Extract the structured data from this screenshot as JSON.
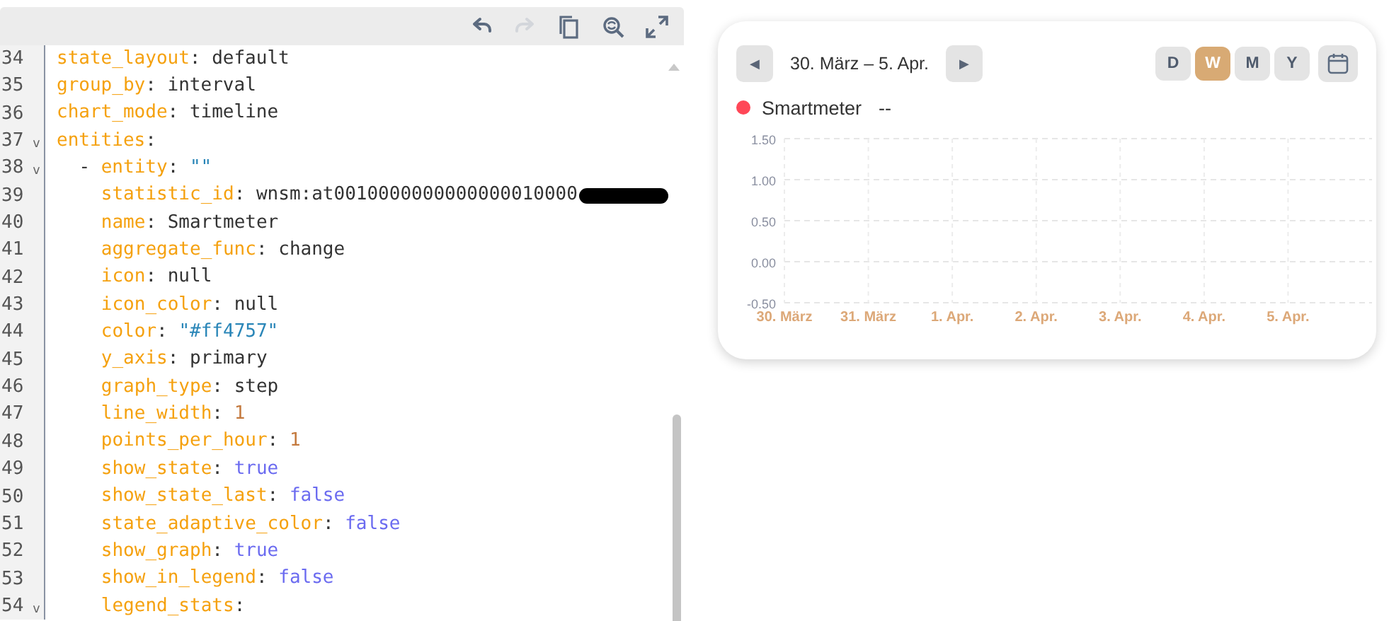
{
  "editor": {
    "toolbar": [
      {
        "kind": "undo",
        "disabled": false
      },
      {
        "kind": "redo",
        "disabled": true
      },
      {
        "kind": "copy",
        "disabled": false
      },
      {
        "kind": "search",
        "disabled": false
      },
      {
        "kind": "expand",
        "disabled": false
      }
    ],
    "lines": [
      {
        "number": "34",
        "tokens": [
          {
            "kind": "key",
            "text": "state_layout"
          },
          {
            "kind": "punct",
            "text": ": "
          },
          {
            "kind": "plain",
            "text": "default"
          }
        ]
      },
      {
        "number": "35",
        "tokens": [
          {
            "kind": "key",
            "text": "group_by"
          },
          {
            "kind": "punct",
            "text": ": "
          },
          {
            "kind": "plain",
            "text": "interval"
          }
        ]
      },
      {
        "number": "36",
        "tokens": [
          {
            "kind": "key",
            "text": "chart_mode"
          },
          {
            "kind": "punct",
            "text": ": "
          },
          {
            "kind": "plain",
            "text": "timeline"
          }
        ]
      },
      {
        "number": "37",
        "fold": "v",
        "tokens": [
          {
            "kind": "key",
            "text": "entities"
          },
          {
            "kind": "punct",
            "text": ":"
          }
        ],
        "children": [
          {
            "number": "38",
            "fold": "v",
            "tokens": [
              {
                "kind": "punct",
                "text": "- "
              },
              {
                "kind": "key",
                "text": "entity"
              },
              {
                "kind": "punct",
                "text": ": "
              },
              {
                "kind": "string",
                "text": "\"\""
              }
            ],
            "children": [
              {
                "number": "39",
                "redacted": true,
                "tokens": [
                  {
                    "kind": "key",
                    "text": "statistic_id"
                  },
                  {
                    "kind": "punct",
                    "text": ": "
                  },
                  {
                    "kind": "plain",
                    "text": "wnsm:at0010000000000000010000"
                  }
                ]
              },
              {
                "number": "40",
                "tokens": [
                  {
                    "kind": "key",
                    "text": "name"
                  },
                  {
                    "kind": "punct",
                    "text": ": "
                  },
                  {
                    "kind": "plain",
                    "text": "Smartmeter"
                  }
                ]
              },
              {
                "number": "41",
                "tokens": [
                  {
                    "kind": "key",
                    "text": "aggregate_func"
                  },
                  {
                    "kind": "punct",
                    "text": ": "
                  },
                  {
                    "kind": "plain",
                    "text": "change"
                  }
                ]
              },
              {
                "number": "42",
                "tokens": [
                  {
                    "kind": "key",
                    "text": "icon"
                  },
                  {
                    "kind": "punct",
                    "text": ": "
                  },
                  {
                    "kind": "plain",
                    "text": "null"
                  }
                ]
              },
              {
                "number": "43",
                "tokens": [
                  {
                    "kind": "key",
                    "text": "icon_color"
                  },
                  {
                    "kind": "punct",
                    "text": ": "
                  },
                  {
                    "kind": "plain",
                    "text": "null"
                  }
                ]
              },
              {
                "number": "44",
                "tokens": [
                  {
                    "kind": "key",
                    "text": "color"
                  },
                  {
                    "kind": "punct",
                    "text": ": "
                  },
                  {
                    "kind": "string",
                    "text": "\"#ff4757\""
                  }
                ]
              },
              {
                "number": "45",
                "tokens": [
                  {
                    "kind": "key",
                    "text": "y_axis"
                  },
                  {
                    "kind": "punct",
                    "text": ": "
                  },
                  {
                    "kind": "plain",
                    "text": "primary"
                  }
                ]
              },
              {
                "number": "46",
                "tokens": [
                  {
                    "kind": "key",
                    "text": "graph_type"
                  },
                  {
                    "kind": "punct",
                    "text": ": "
                  },
                  {
                    "kind": "plain",
                    "text": "step"
                  }
                ]
              },
              {
                "number": "47",
                "tokens": [
                  {
                    "kind": "key",
                    "text": "line_width"
                  },
                  {
                    "kind": "punct",
                    "text": ": "
                  },
                  {
                    "kind": "number",
                    "text": "1"
                  }
                ]
              },
              {
                "number": "48",
                "tokens": [
                  {
                    "kind": "key",
                    "text": "points_per_hour"
                  },
                  {
                    "kind": "punct",
                    "text": ": "
                  },
                  {
                    "kind": "number",
                    "text": "1"
                  }
                ]
              },
              {
                "number": "49",
                "tokens": [
                  {
                    "kind": "key",
                    "text": "show_state"
                  },
                  {
                    "kind": "punct",
                    "text": ": "
                  },
                  {
                    "kind": "bool",
                    "text": "true"
                  }
                ]
              },
              {
                "number": "50",
                "tokens": [
                  {
                    "kind": "key",
                    "text": "show_state_last"
                  },
                  {
                    "kind": "punct",
                    "text": ": "
                  },
                  {
                    "kind": "bool",
                    "text": "false"
                  }
                ]
              },
              {
                "number": "51",
                "tokens": [
                  {
                    "kind": "key",
                    "text": "state_adaptive_color"
                  },
                  {
                    "kind": "punct",
                    "text": ": "
                  },
                  {
                    "kind": "bool",
                    "text": "false"
                  }
                ]
              },
              {
                "number": "52",
                "tokens": [
                  {
                    "kind": "key",
                    "text": "show_graph"
                  },
                  {
                    "kind": "punct",
                    "text": ": "
                  },
                  {
                    "kind": "bool",
                    "text": "true"
                  }
                ]
              },
              {
                "number": "53",
                "tokens": [
                  {
                    "kind": "key",
                    "text": "show_in_legend"
                  },
                  {
                    "kind": "punct",
                    "text": ": "
                  },
                  {
                    "kind": "bool",
                    "text": "false"
                  }
                ]
              },
              {
                "number": "54",
                "fold": "v",
                "tokens": [
                  {
                    "kind": "key",
                    "text": "legend_stats"
                  },
                  {
                    "kind": "punct",
                    "text": ":"
                  }
                ]
              }
            ]
          }
        ]
      }
    ]
  },
  "card": {
    "prev": "◀",
    "range": "30. März – 5. Apr.",
    "next": "▶",
    "periods": [
      {
        "label": "D",
        "selected": false
      },
      {
        "label": "W",
        "selected": true
      },
      {
        "label": "M",
        "selected": false
      },
      {
        "label": "Y",
        "selected": false
      }
    ],
    "legend": {
      "name": "Smartmeter",
      "value": "--",
      "color": "#ff4757"
    },
    "chart_data": {
      "type": "line",
      "categories": [
        "30. März",
        "31. März",
        "1. Apr.",
        "2. Apr.",
        "3. Apr.",
        "4. Apr.",
        "5. Apr."
      ],
      "grid": true,
      "ylim": [
        -0.5,
        1.5
      ],
      "yticks": [
        {
          "value": 1.5,
          "label": "1.50"
        },
        {
          "value": 1,
          "label": "1.00"
        },
        {
          "value": 0.5,
          "label": "0.50"
        },
        {
          "value": 0,
          "label": "0.00"
        },
        {
          "value": -0.5,
          "label": "-0.50"
        }
      ]
    }
  }
}
